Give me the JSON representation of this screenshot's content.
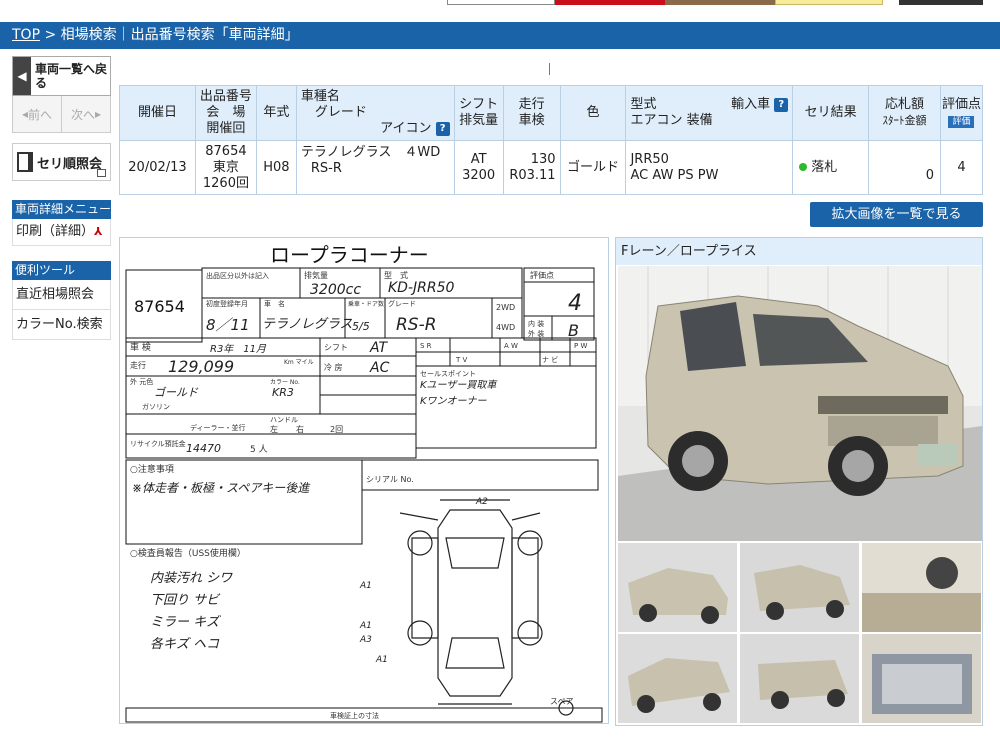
{
  "breadcrumb": {
    "top_link": "TOP",
    "rest": " > 相場検索｜出品番号検索「車両詳細」"
  },
  "sidebar": {
    "back_label": "車両一覧へ戻る",
    "prev_label": "前へ",
    "next_label": "次へ",
    "seri_label": "セリ順照会",
    "menu_title": "車両詳細メニュー",
    "print_label": "印刷（詳細）",
    "tools_title": "便利ツール",
    "items": [
      {
        "label": "直近相場照会"
      },
      {
        "label": "カラーNo.検索"
      }
    ]
  },
  "table": {
    "headers": {
      "date": "開催日",
      "lot_l1": "出品番号",
      "lot_l2": "会　場",
      "lot_l3": "開催回",
      "year": "年式",
      "name_l1": "車種名",
      "name_l2": "グレード",
      "name_icon": "アイコン",
      "shift_l1": "シフト",
      "shift_l2": "排気量",
      "run_l1": "走行",
      "run_l2": "車検",
      "color": "色",
      "model_l1": "型式",
      "model_import": "輸入車",
      "model_l2": "エアコン 装備",
      "result": "セリ結果",
      "price_l1": "応札額",
      "price_l2": "ｽﾀｰﾄ金額",
      "score": "評価点",
      "score_badge": "評価"
    },
    "row": {
      "date": "20/02/13",
      "lot": "87654",
      "venue": "東京",
      "session": "1260回",
      "year": "H08",
      "name": "テラノレグラス　４WD",
      "grade": "RS-R",
      "shift": "AT",
      "displacement": "3200",
      "mileage": "130",
      "inspection": "R03.11",
      "color": "ゴールド",
      "model": "JRR50",
      "equipment": "AC AW PS PW",
      "result": "落札",
      "price": "0",
      "score": "4"
    }
  },
  "enlarge_button": "拡大画像を一覧で見る",
  "sheet": {
    "title": "ロープラコーナー",
    "lot_no": "87654",
    "labels": {
      "exhibit": "出品区分以外は記入",
      "displacement_h": "排気量",
      "model_h": "型　式",
      "score_h": "評価点",
      "reg_h": "初度登録年月",
      "name_h": "車　名",
      "door_h": "乗車・ドア数",
      "grade_h": "グレード",
      "inspect_h": "車 検",
      "shift_h": "シフト",
      "mileage_h": "走行",
      "km_h": "Km マイル",
      "ac_h": "冷 房",
      "color_h": "外 元色",
      "color_no_h": "カラー No.",
      "fuel_h": "ガソリン",
      "purchase_h": "ディーラー・並行",
      "handle_h": "ハンドル",
      "recycle_h": "リサイクル預託金",
      "notes_h": "○注意事項",
      "serial_h": "シリアル No.",
      "report_h": "○検査員報告（USS使用欄）",
      "sales_h": "セールスポイント",
      "spare": "スペア",
      "size_h": "車検証上の寸法",
      "interior_h": "内 装",
      "exterior_h": "外 装",
      "wd2": "2WD",
      "wd4": "4WD",
      "sr": "S R",
      "aw": "A W",
      "pw": "P W",
      "tv": "T V",
      "navi": "ナ ビ",
      "left": "左",
      "right": "右",
      "twice": "2回",
      "fiveppl": "5 人"
    },
    "handwritten": {
      "displacement": "3200cc",
      "model": "KD-JRR50",
      "score": "4",
      "interior": "B",
      "reg": "8／11",
      "name": "テラノレグラス",
      "doors": "5/5",
      "grade": "RS-R",
      "inspect": "R3年　11月",
      "shift": "AT",
      "mileage": "129,099",
      "ac": "AC",
      "color": "ゴールド",
      "color_no": "KR3",
      "recycle": "14470",
      "notes": "※体走者・板極・スペアキー後進",
      "sales1": "Kユーザー買取車",
      "sales2": "Kワンオーナー",
      "report1": "内装汚れ シワ",
      "report2": "下回り サビ",
      "report3": "ミラー キズ",
      "report4": "各キズ ヘコ",
      "rear_note": "A2",
      "dent1": "A1",
      "dent2": "A1",
      "dent3": "A3",
      "dent4": "A1"
    }
  },
  "photos": {
    "title": "Fレーン／ロープライス"
  },
  "colors": {
    "accent": "#1a63a8",
    "header_bg": "#dfeefa",
    "success": "#2db82d"
  }
}
